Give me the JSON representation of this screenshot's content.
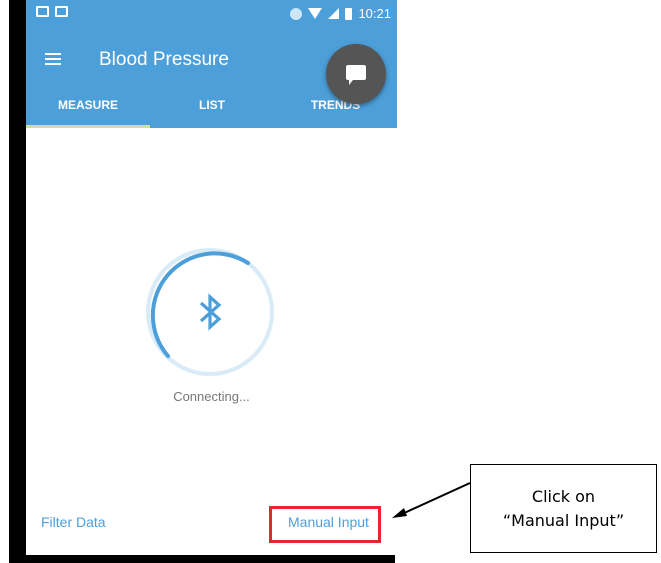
{
  "status_bar": {
    "time": "10:21"
  },
  "toolbar": {
    "title": "Blood Pressure"
  },
  "tabs": [
    {
      "label": "MEASURE",
      "selected": true
    },
    {
      "label": "LIST",
      "selected": false
    },
    {
      "label": "TRENDS",
      "selected": false
    }
  ],
  "main": {
    "status": "Connecting..."
  },
  "footer": {
    "filter_label": "Filter Data",
    "manual_label": "Manual Input"
  },
  "callout": {
    "line1": "Click on",
    "line2": "“Manual Input”"
  },
  "colors": {
    "accent": "#4c9fd9",
    "highlight": "#e8262c",
    "fab": "#555555"
  },
  "icons": [
    "menu-icon",
    "chat-icon",
    "bluetooth-icon"
  ]
}
